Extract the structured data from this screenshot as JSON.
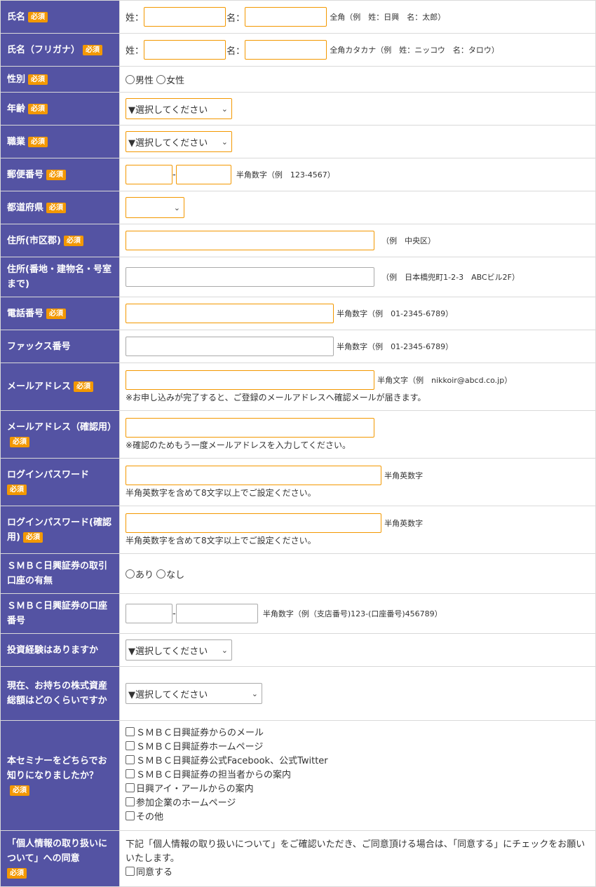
{
  "required_badge": "必須",
  "rows": {
    "name": {
      "label": "氏名",
      "sei": "姓：",
      "mei": "名：",
      "note": "全角（例　姓：日興　名：太郎）"
    },
    "kana": {
      "label": "氏名（フリガナ）",
      "sei": "姓：",
      "mei": "名：",
      "note": "全角カタカナ（例　姓：ニッコウ　名：タロウ）"
    },
    "gender": {
      "label": "性別",
      "options": [
        "男性",
        "女性"
      ]
    },
    "age": {
      "label": "年齢",
      "placeholder": "▼選択してください"
    },
    "job": {
      "label": "職業",
      "placeholder": "▼選択してください"
    },
    "zip": {
      "label": "郵便番号",
      "sep": "-",
      "note": "半角数字（例　123-4567）"
    },
    "pref": {
      "label": "都道府県",
      "value": ""
    },
    "addr1": {
      "label": "住所(市区郡)",
      "note": "（例　中央区）"
    },
    "addr2": {
      "label": "住所(番地・建物名・号室まで)",
      "note": "（例　日本橋兜町1-2-3　ABCビル2F）"
    },
    "tel": {
      "label": "電話番号",
      "note": "半角数字（例　01-2345-6789）"
    },
    "fax": {
      "label": "ファックス番号",
      "note": "半角数字（例　01-2345-6789）"
    },
    "email": {
      "label": "メールアドレス",
      "note": "半角文字（例　nikkoir@abcd.co.jp）",
      "sub": "※お申し込みが完了すると、ご登録のメールアドレスへ確認メールが届きます。"
    },
    "email2": {
      "label": "メールアドレス（確認用）",
      "sub": "※確認のためもう一度メールアドレスを入力してください。"
    },
    "pw": {
      "label": "ログインパスワード",
      "note": "半角英数字",
      "sub": "半角英数字を含めて8文字以上でご設定ください。"
    },
    "pw2": {
      "label": "ログインパスワード(確認用)",
      "note": "半角英数字",
      "sub": "半角英数字を含めて8文字以上でご設定ください。"
    },
    "account": {
      "label": "ＳＭＢＣ日興証券の取引口座の有無",
      "options": [
        "あり",
        "なし"
      ]
    },
    "accno": {
      "label": "ＳＭＢＣ日興証券の口座番号",
      "sep": "-",
      "note": "半角数字（例（支店番号)123-(口座番号)456789）"
    },
    "exp": {
      "label": "投資経験はありますか",
      "placeholder": "▼選択してください"
    },
    "assets": {
      "label": "現在、お持ちの株式資産総額はどのくらいですか",
      "placeholder": "▼選択してください"
    },
    "source": {
      "label": "本セミナーをどちらでお知りになりましたか？",
      "options": [
        "ＳＭＢＣ日興証券からのメール",
        "ＳＭＢＣ日興証券ホームページ",
        "ＳＭＢＣ日興証券公式Facebook、公式Twitter",
        "ＳＭＢＣ日興証券の担当者からの案内",
        "日興アイ・アールからの案内",
        "参加企業のホームページ",
        "その他"
      ]
    },
    "privacy": {
      "label": "「個人情報の取り扱いについて」への同意",
      "text": "下記「個人情報の取り扱いについて」をご確認いただき、ご同意頂ける場合は、「同意する」にチェックをお願いいたします。",
      "agree": "同意する"
    }
  }
}
